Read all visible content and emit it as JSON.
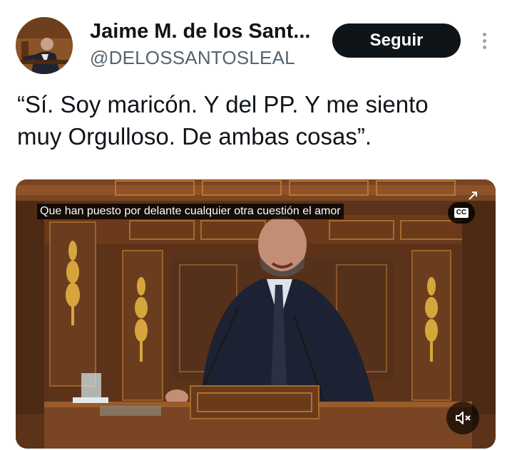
{
  "author": {
    "name": "Jaime M. de los Sant...",
    "handle": "@DELOSSANTOSLEAL",
    "avatar_icon": "profile-photo"
  },
  "actions": {
    "follow_label": "Seguir",
    "more_icon": "vertical-ellipsis-icon"
  },
  "tweet": {
    "lines": [
      "“Sí. Soy maricón. Y del PP. Y me siento",
      "muy Orgulloso. De ambas cosas”."
    ]
  },
  "video": {
    "caption": "Que han puesto por delante cualquier otra cuestión el amor",
    "cc_label": "CC",
    "mute_icon": "speaker-muted-icon"
  },
  "colors": {
    "text": "#0f1419",
    "secondary": "#536471",
    "button_bg": "#0f1419",
    "wood": "#6b3d1f"
  }
}
